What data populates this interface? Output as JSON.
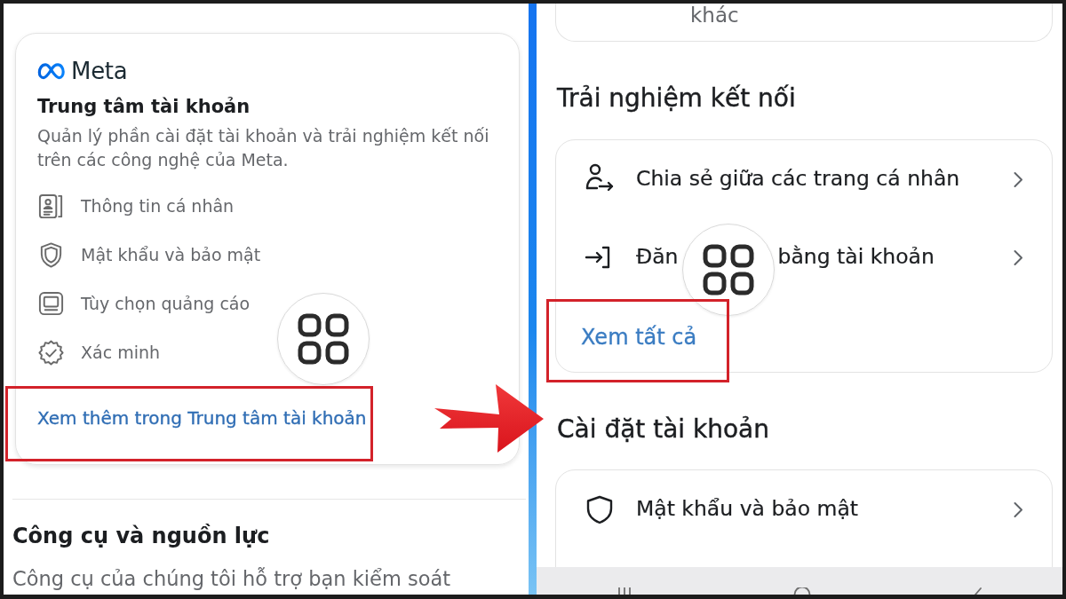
{
  "left_panel": {
    "accounts_center_card": {
      "logo_text": "Meta",
      "title": "Trung tâm tài khoản",
      "description": "Quản lý phần cài đặt tài khoản và trải nghiệm kết nối trên các công nghệ của Meta.",
      "items": [
        {
          "kind": "personal_info",
          "label": "Thông tin cá nhân"
        },
        {
          "kind": "security",
          "label": "Mật khẩu và bảo mật"
        },
        {
          "kind": "ads",
          "label": "Tùy chọn quảng cáo"
        },
        {
          "kind": "verification",
          "label": "Xác minh"
        }
      ],
      "see_more_link": {
        "text": "Xem thêm trong Trung tâm tài khoản",
        "highlighted": true
      }
    },
    "tools_section": {
      "title": "Công cụ và nguồn lực",
      "description": "Công cụ của chúng tôi hỗ trợ bạn kiểm soát"
    }
  },
  "right_panel": {
    "top_card": {
      "text": "khác"
    },
    "connected_experiences": {
      "title": "Trải nghiệm kết nối",
      "items": [
        {
          "kind": "share",
          "label_parts": [
            "Chia sẻ giữa các trang cá nhân"
          ]
        },
        {
          "kind": "login",
          "label_parts": [
            "Đăn",
            "bằng tài khoản"
          ]
        }
      ],
      "see_all_link": {
        "text": "Xem tất cả",
        "highlighted": true
      }
    },
    "account_settings": {
      "title": "Cài đặt tài khoản",
      "items": [
        {
          "kind": "security",
          "label_parts": [
            "Mật khẩu và bảo mật"
          ]
        }
      ]
    }
  }
}
